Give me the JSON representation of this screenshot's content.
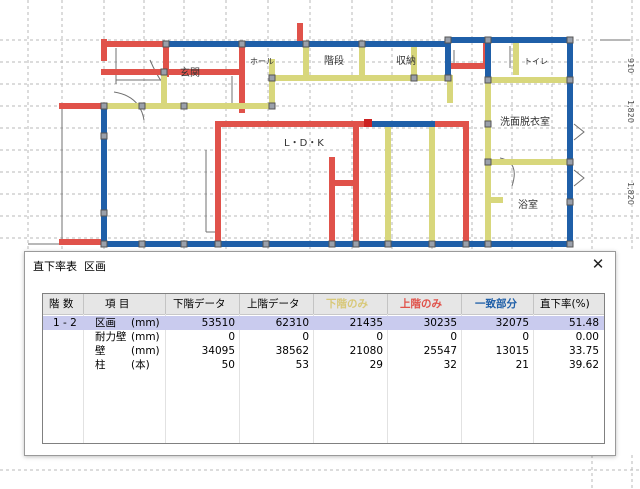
{
  "plan": {
    "room_labels": [
      "玄関",
      "ホール",
      "階段",
      "収納",
      "トイレ",
      "L・D・K",
      "洗面脱衣室",
      "浴室"
    ],
    "dims": [
      "910",
      "1,820",
      "1,820"
    ],
    "colors": {
      "lower": "#e0524a",
      "upper": "#d8d77c",
      "match": "#1f5fa8"
    }
  },
  "dialog": {
    "title": "直下率表  区画",
    "close": "✕",
    "columns": [
      "階 数",
      "項   目",
      "下階データ",
      "上階データ",
      "下階のみ",
      "上階のみ",
      "一致部分",
      "直下率(%)"
    ],
    "column_colors": [
      "#000000",
      "#000000",
      "#000000",
      "#000000",
      "#d8c878",
      "#e0524a",
      "#1f5fa8",
      "#000000"
    ],
    "rows": [
      {
        "level": "1 - 2",
        "item": "区画",
        "unit": "(mm)",
        "lower": "53510",
        "upper": "62310",
        "lower_only": "21435",
        "upper_only": "30235",
        "match": "32075",
        "rate": "51.48"
      },
      {
        "level": "",
        "item": "耐力壁",
        "unit": "(mm)",
        "lower": "0",
        "upper": "0",
        "lower_only": "0",
        "upper_only": "0",
        "match": "0",
        "rate": "0.00"
      },
      {
        "level": "",
        "item": "壁",
        "unit": "(mm)",
        "lower": "34095",
        "upper": "38562",
        "lower_only": "21080",
        "upper_only": "25547",
        "match": "13015",
        "rate": "33.75"
      },
      {
        "level": "",
        "item": "柱",
        "unit": "(本)",
        "lower": "50",
        "upper": "53",
        "lower_only": "29",
        "upper_only": "32",
        "match": "21",
        "rate": "39.62"
      }
    ]
  }
}
